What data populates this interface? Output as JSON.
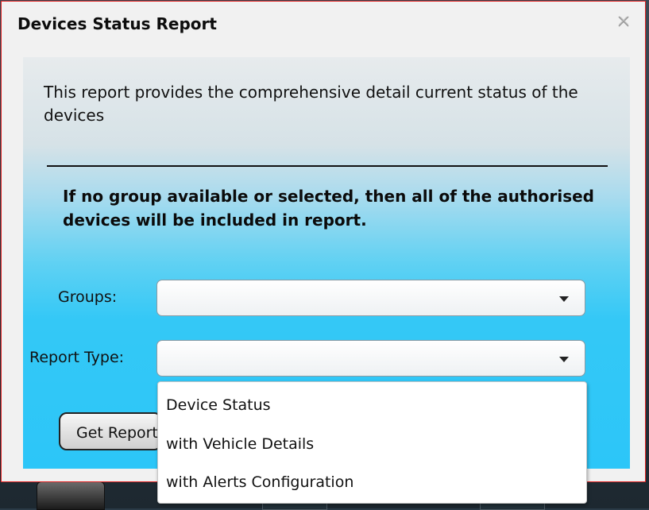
{
  "dialog": {
    "title": "Devices Status Report",
    "close_icon": "close-icon",
    "description": "This report provides the comprehensive detail current status of the devices",
    "note": "If no group available or selected, then all of the authorised devices will be included in report."
  },
  "form": {
    "groups_label": "Groups:",
    "groups_value": "",
    "report_type_label": "Report Type:",
    "report_type_value": "",
    "get_report_label": "Get Report"
  },
  "report_type_options": [
    "Device Status",
    "with Vehicle Details",
    "with Alerts Configuration"
  ],
  "colors": {
    "accent": "#2cc6f8",
    "border": "#e02020"
  }
}
